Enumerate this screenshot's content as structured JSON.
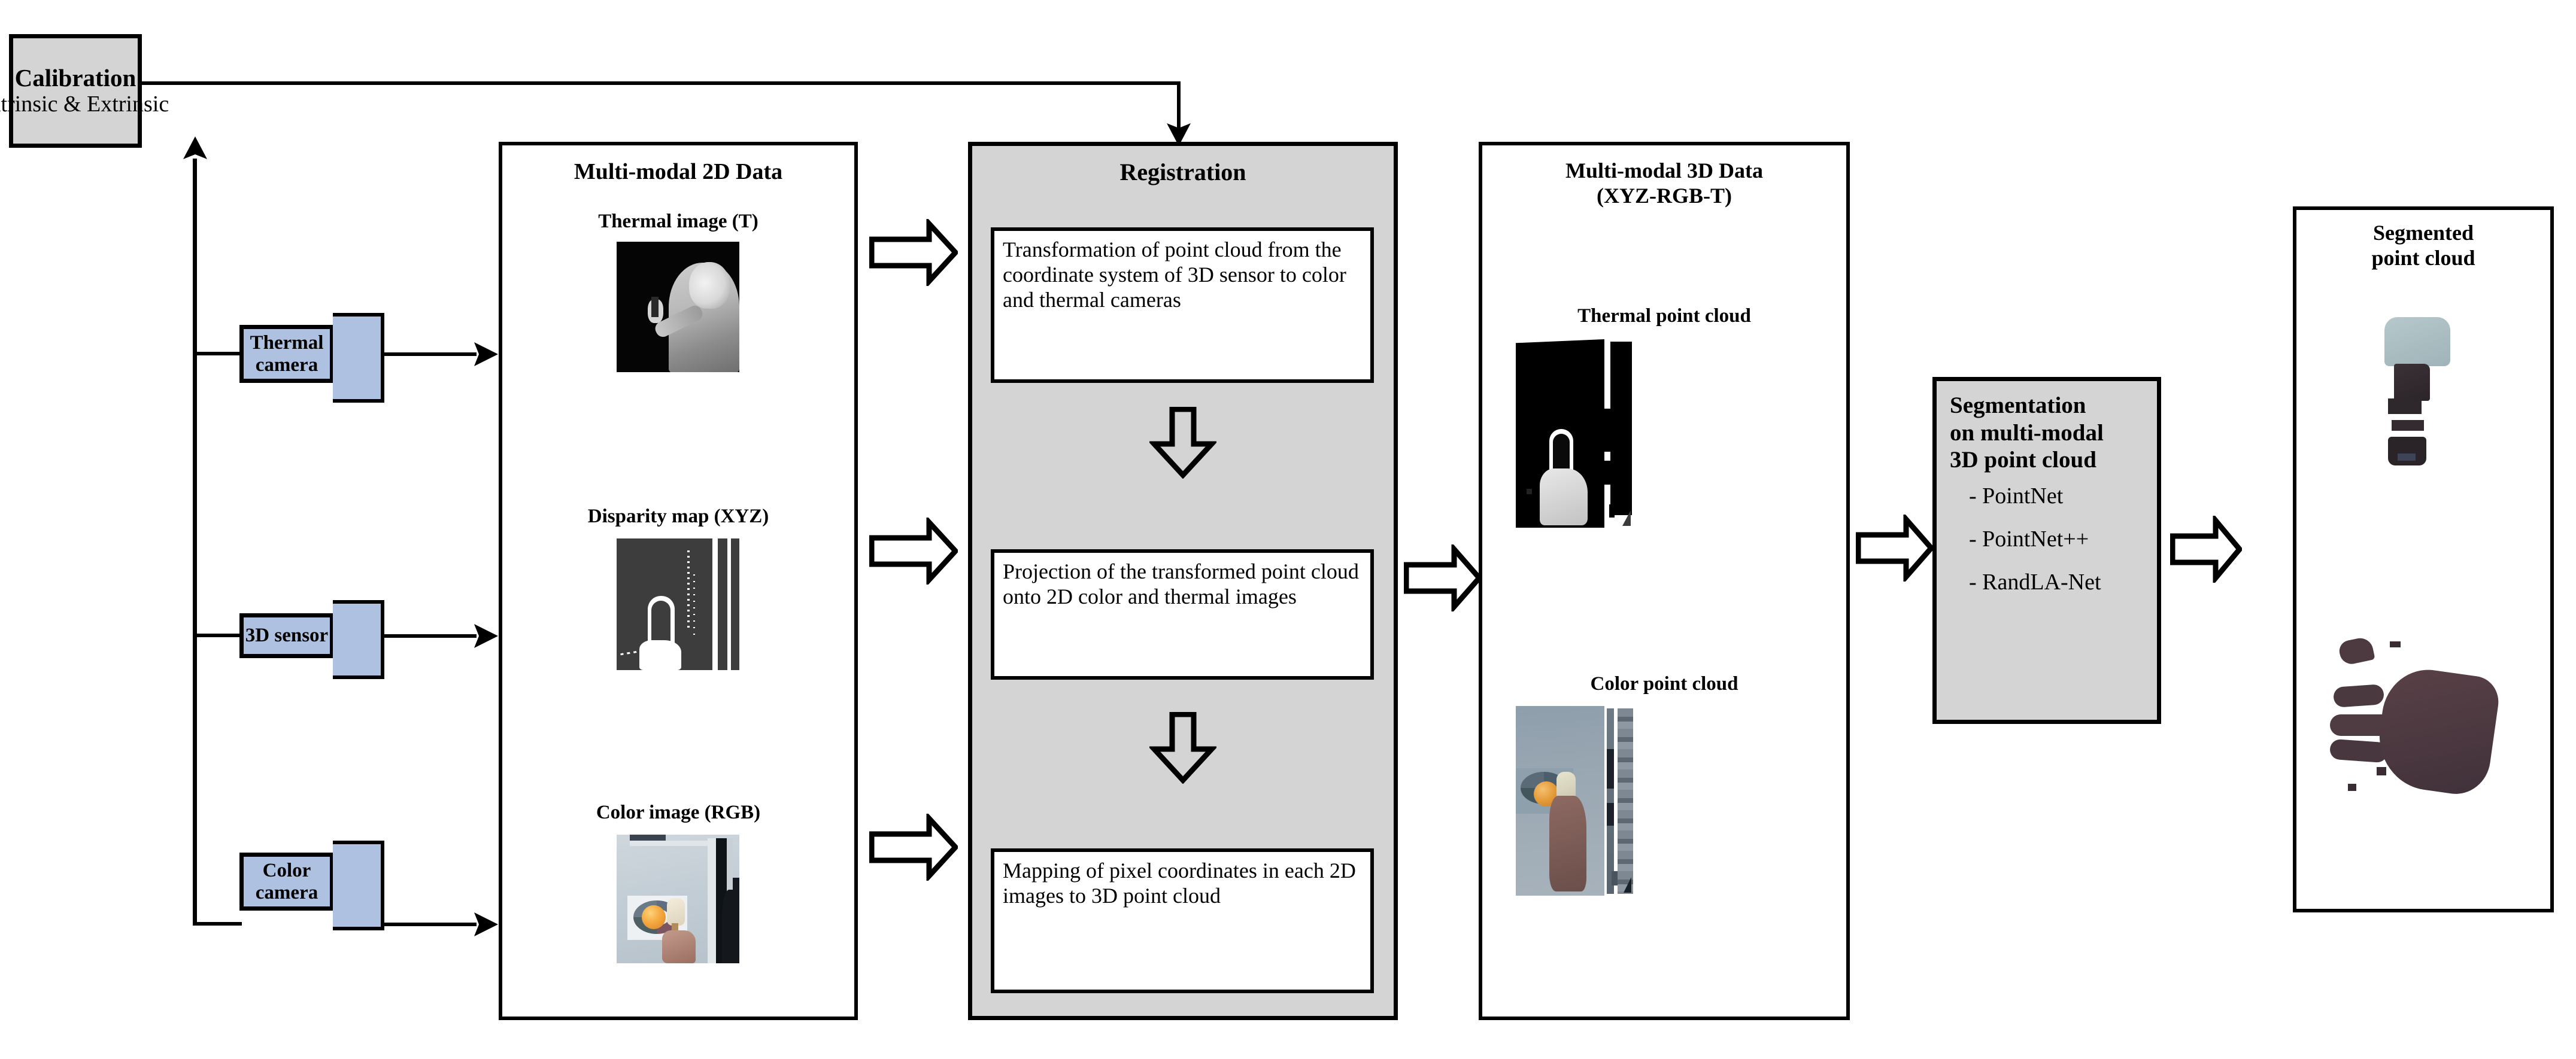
{
  "calibration": {
    "title": "Calibration",
    "subtitle": "Intrinsic & Extrinsic"
  },
  "sensors": [
    {
      "label": "Thermal\ncamera",
      "name": "thermal-camera"
    },
    {
      "label": "3D sensor",
      "name": "3d-sensor"
    },
    {
      "label": "Color\ncamera",
      "name": "color-camera"
    }
  ],
  "panel_2d": {
    "title": "Multi-modal 2D Data",
    "images": [
      {
        "caption": "Thermal image (T)"
      },
      {
        "caption": "Disparity map (XYZ)"
      },
      {
        "caption": "Color image (RGB)"
      }
    ]
  },
  "registration": {
    "title": "Registration",
    "steps": [
      "Transformation of point cloud from the coordinate system of 3D sensor to color and thermal cameras",
      "Projection of the transformed point cloud onto 2D color and thermal images",
      "Mapping of pixel coordinates in each 2D images to 3D point cloud"
    ]
  },
  "panel_3d": {
    "title_line1": "Multi-modal 3D Data",
    "title_line2": "(XYZ-RGB-T)",
    "images": [
      {
        "caption": "Thermal point cloud"
      },
      {
        "caption": "Color point cloud"
      }
    ]
  },
  "segmentation": {
    "title_line1": "Segmentation",
    "title_line2": "on multi-modal",
    "title_line3": "3D point cloud",
    "methods": [
      "- PointNet",
      "- PointNet++",
      "- RandLA-Net"
    ]
  },
  "output": {
    "title_line1": "Segmented",
    "title_line2": "point cloud"
  },
  "colors": {
    "gray_fill": "#d4d4d4",
    "camera_fill": "#aec1e0",
    "outline": "#000000",
    "page_bg": "#ffffff"
  }
}
